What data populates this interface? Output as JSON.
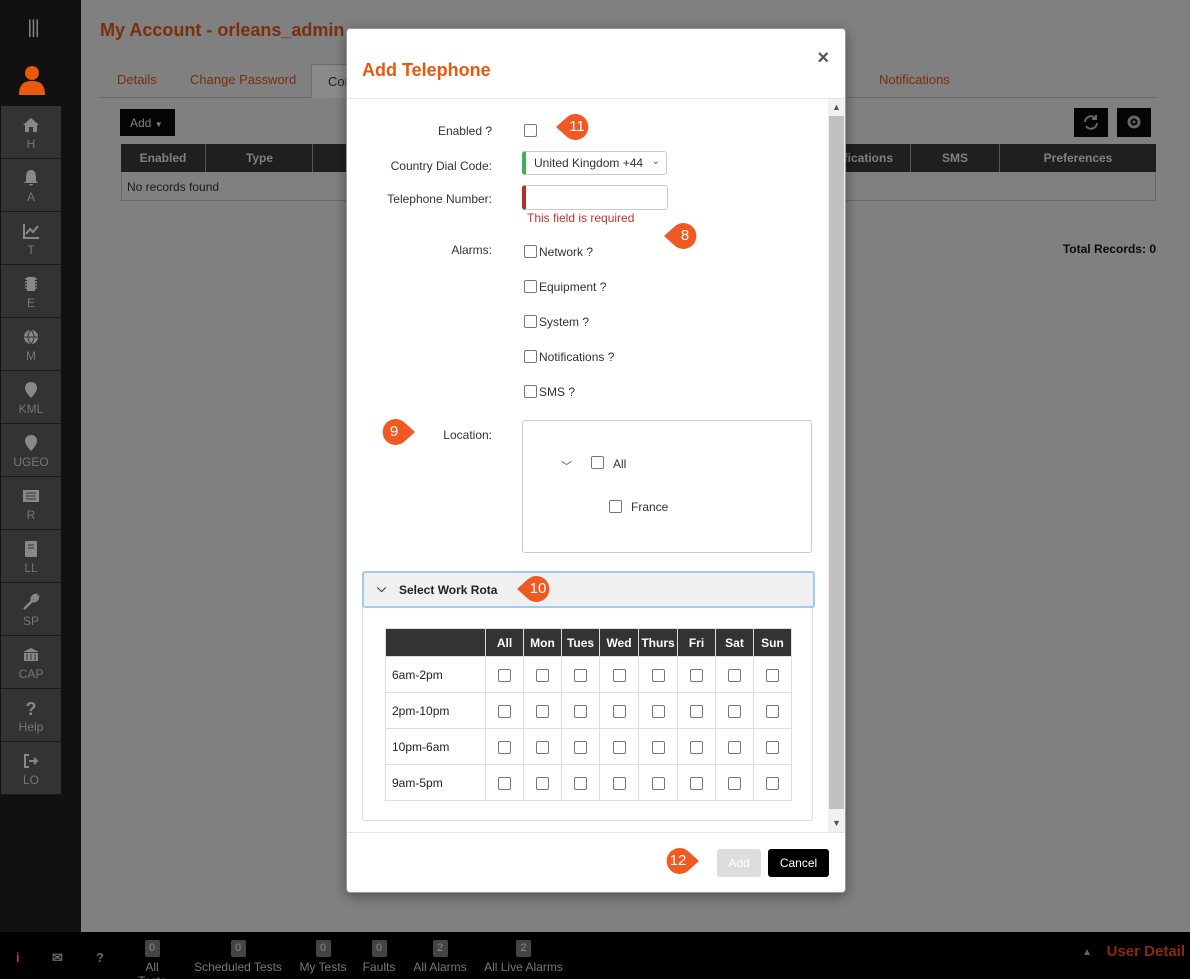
{
  "sidebar": {
    "items": [
      {
        "label": "H",
        "icon": "home-icon"
      },
      {
        "label": "A",
        "icon": "bell-icon"
      },
      {
        "label": "T",
        "icon": "chart-icon"
      },
      {
        "label": "E",
        "icon": "chip-icon"
      },
      {
        "label": "M",
        "icon": "globe-icon"
      },
      {
        "label": "KML",
        "icon": "map-pin-icon"
      },
      {
        "label": "UGEO",
        "icon": "map-pin-icon"
      },
      {
        "label": "R",
        "icon": "list-icon"
      },
      {
        "label": "LL",
        "icon": "book-icon"
      },
      {
        "label": "SP",
        "icon": "wrench-icon"
      },
      {
        "label": "CAP",
        "icon": "bank-icon"
      },
      {
        "label": "Help",
        "icon": "question-icon"
      },
      {
        "label": "LO",
        "icon": "logout-icon"
      }
    ]
  },
  "page": {
    "title": "My Account - orleans_admin",
    "tabs": [
      "Details",
      "Change Password",
      "Cor",
      "Notifications"
    ],
    "add_label": "Add",
    "table_headers": [
      "Enabled",
      "Type",
      "otifications",
      "SMS",
      "Preferences"
    ],
    "no_records": "No records found",
    "total_records": "Total Records: 0"
  },
  "modal": {
    "title": "Add Telephone",
    "close": "×",
    "enabled_label": "Enabled ?",
    "country_label": "Country Dial Code:",
    "country_value": "United Kingdom +44",
    "phone_label": "Telephone Number:",
    "phone_error": "This field is required",
    "alarms_label": "Alarms:",
    "alarms": [
      "Network ?",
      "Equipment ?",
      "System ?",
      "Notifications ?",
      "SMS ?"
    ],
    "location_label": "Location:",
    "location_tree": [
      "All",
      "France"
    ],
    "rota_title": "Select Work Rota",
    "rota_days": [
      "All",
      "Mon",
      "Tues",
      "Wed",
      "Thurs",
      "Fri",
      "Sat",
      "Sun"
    ],
    "rota_shifts": [
      "6am-2pm",
      "2pm-10pm",
      "10pm-6am",
      "9am-5pm"
    ],
    "add_button": "Add",
    "cancel_button": "Cancel"
  },
  "callouts": [
    "11",
    "8",
    "9",
    "10",
    "12"
  ],
  "bottombar": {
    "items": [
      {
        "label": "All Tests",
        "count": "0"
      },
      {
        "label": "Scheduled Tests",
        "count": "0"
      },
      {
        "label": "My Tests",
        "count": "0"
      },
      {
        "label": "Faults",
        "count": "0"
      },
      {
        "label": "All Alarms",
        "count": "2"
      },
      {
        "label": "All Live Alarms",
        "count": "2"
      }
    ],
    "user_detail": "User Detail"
  },
  "colors": {
    "accent": "#e8590c",
    "callout": "#f05a22",
    "valid": "#3cb44b",
    "invalid": "#b03030"
  }
}
